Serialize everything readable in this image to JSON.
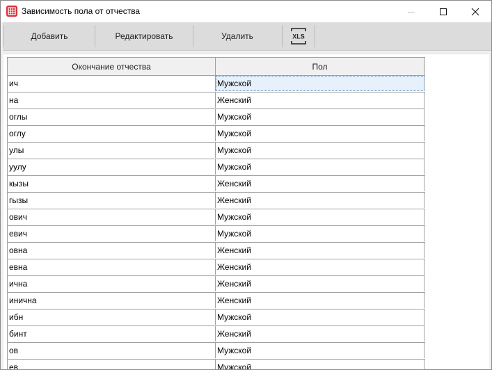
{
  "window": {
    "title": "Зависимость пола от отчества",
    "icon": "grid-app-icon"
  },
  "toolbar": {
    "add_label": "Добавить",
    "edit_label": "Редактировать",
    "delete_label": "Удалить",
    "export_icon_text": "XLS"
  },
  "table": {
    "columns": [
      "Окончание отчества",
      "Пол"
    ],
    "rows": [
      [
        "ич",
        "Мужской"
      ],
      [
        "на",
        "Женский"
      ],
      [
        "оглы",
        "Мужской"
      ],
      [
        "оглу",
        "Мужской"
      ],
      [
        "улы",
        "Мужской"
      ],
      [
        "уулу",
        "Мужской"
      ],
      [
        "кызы",
        "Женский"
      ],
      [
        "гызы",
        "Женский"
      ],
      [
        "ович",
        "Мужской"
      ],
      [
        "евич",
        "Мужской"
      ],
      [
        "овна",
        "Женский"
      ],
      [
        "евна",
        "Женский"
      ],
      [
        "ична",
        "Женский"
      ],
      [
        "инична",
        "Женский"
      ],
      [
        "ибн",
        "Мужской"
      ],
      [
        "бинт",
        "Женский"
      ],
      [
        "ов",
        "Мужской"
      ],
      [
        "ев",
        "Мужской"
      ]
    ],
    "selected_row": 0
  }
}
